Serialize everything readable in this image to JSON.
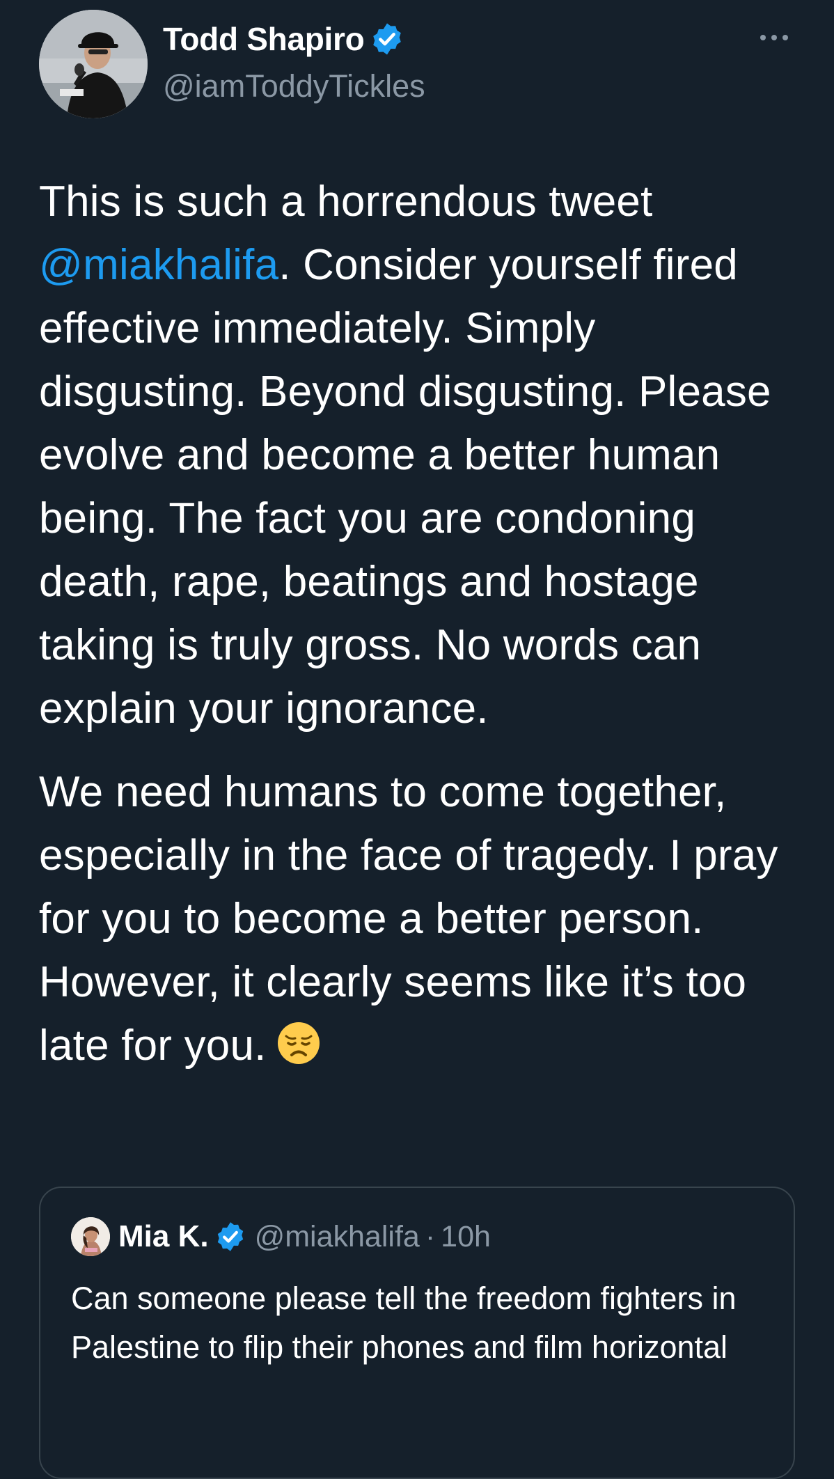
{
  "author": {
    "name": "Todd Shapiro",
    "handle": "@iamToddyTickles"
  },
  "tweet": {
    "paragraph1_before": "This is such a horrendous tweet",
    "mention": "@miakhalifa",
    "paragraph1_after": ". Consider yourself fired effective immediately. Simply disgusting. Beyond disgusting. Please evolve and become a better human being. The fact you are condoning death, rape, beatings and hostage taking is truly gross. No words can explain your ignorance.",
    "paragraph2": "We need humans to come together, especially in the face of tragedy. I pray for you to become a better person. However, it clearly seems like it’s too late for you.",
    "emoji": "disappointed-face"
  },
  "quoted_tweet": {
    "name": "Mia K.",
    "handle": "@miakhalifa",
    "separator": "·",
    "time": "10h",
    "text": "Can someone please tell the freedom fighters in Palestine to flip their phones and film horizontal"
  },
  "colors": {
    "background": "#15202b",
    "text": "#ffffff",
    "secondary_text": "#8b98a5",
    "link": "#1d9bf0",
    "verified_badge": "#1d9bf0",
    "border": "#38444d"
  },
  "icons": {
    "verified": "verified-badge-icon",
    "more": "more-options-icon"
  }
}
